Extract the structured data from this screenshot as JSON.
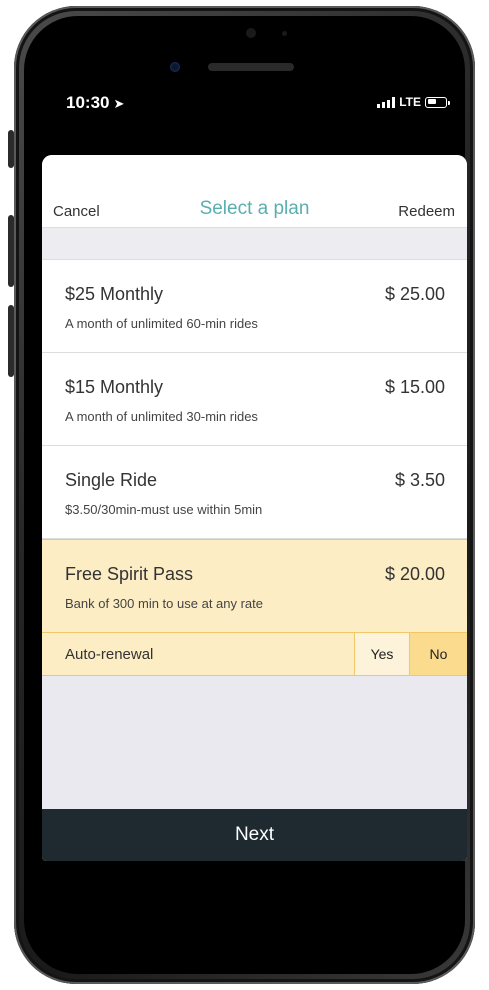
{
  "status_bar": {
    "time": "10:30",
    "location_icon": "location-arrow-icon",
    "network": "LTE",
    "signal_icon": "signal-bars-icon",
    "battery_icon": "battery-icon"
  },
  "nav": {
    "cancel_label": "Cancel",
    "title": "Select a plan",
    "redeem_label": "Redeem"
  },
  "plans": [
    {
      "name": "$25 Monthly",
      "price": "$ 25.00",
      "description": "A month of unlimited 60-min rides"
    },
    {
      "name": "$15 Monthly",
      "price": "$ 15.00",
      "description": "A month of unlimited 30-min rides"
    },
    {
      "name": "Single Ride",
      "price": "$ 3.50",
      "description": "$3.50/30min-must use within 5min"
    },
    {
      "name": "Free Spirit Pass",
      "price": "$ 20.00",
      "description": "Bank of 300 min to use at any rate"
    }
  ],
  "selected_plan_index": 3,
  "auto_renewal": {
    "label": "Auto-renewal",
    "yes_label": "Yes",
    "no_label": "No",
    "selected": "No"
  },
  "next_label": "Next",
  "colors": {
    "title_accent": "#5aaeb0",
    "selected_bg": "#fdedc4",
    "selected_border": "#f0c86a",
    "next_bg": "#1f2a30"
  }
}
